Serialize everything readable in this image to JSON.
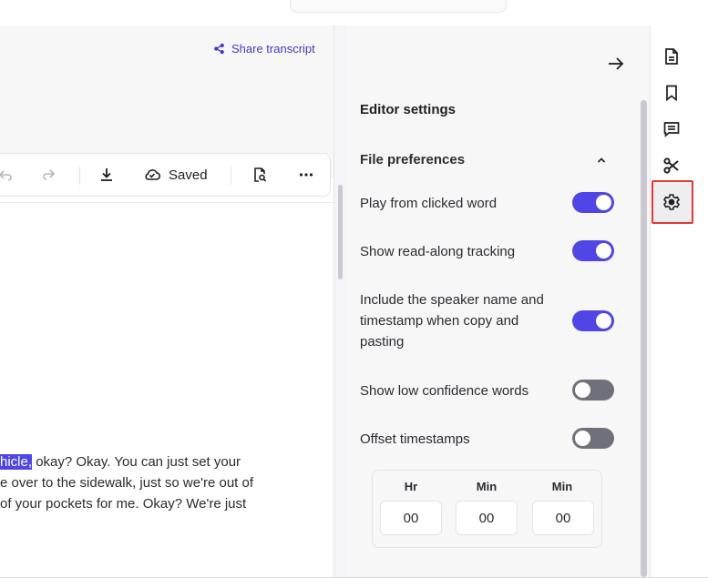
{
  "editor": {
    "share_label": "Share transcript",
    "toolbar": {
      "saved_label": "Saved"
    },
    "transcript_lines": [
      {
        "highlight": "hicle,",
        "rest": " okay? Okay. You can just set your"
      },
      {
        "highlight": "",
        "rest": "e over to the sidewalk, just so we're out of"
      },
      {
        "highlight": "",
        "rest": " of your pockets for me. Okay? We're just"
      }
    ]
  },
  "settings": {
    "title": "Editor settings",
    "section": "File preferences",
    "options": [
      {
        "label": "Play from clicked word",
        "on": true
      },
      {
        "label": "Show read-along tracking",
        "on": true
      },
      {
        "label": "Include the speaker name and timestamp when copy and pasting",
        "on": true
      },
      {
        "label": "Show low confidence words",
        "on": false
      },
      {
        "label": "Offset timestamps",
        "on": false
      }
    ],
    "offset": {
      "columns": [
        {
          "label": "Hr",
          "value": "00"
        },
        {
          "label": "Min",
          "value": "00"
        },
        {
          "label": "Min",
          "value": "00"
        }
      ]
    }
  },
  "rail": {
    "icons": [
      "document-icon",
      "bookmark-icon",
      "comments-icon",
      "scissors-icon",
      "settings-gear-icon"
    ],
    "active": "settings-gear-icon"
  },
  "colors": {
    "accent": "#4f46e5",
    "toggle_off": "#707078",
    "highlight_box": "#e53935"
  }
}
